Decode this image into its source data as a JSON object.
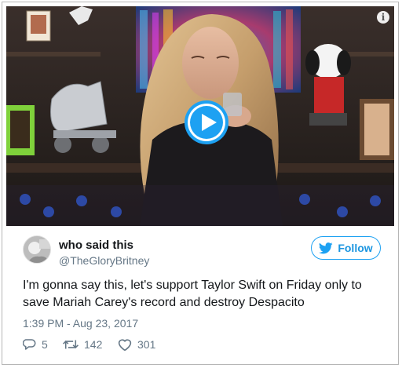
{
  "tweet": {
    "display_name": "who said this",
    "handle": "@TheGloryBritney",
    "follow_label": "Follow",
    "text": "I'm gonna say this, let's support Taylor Swift on Friday only to\nsave Mariah Carey's record and destroy Despacito",
    "timestamp": "1:39 PM - Aug 23, 2017",
    "replies": "5",
    "retweets": "142",
    "likes": "301"
  },
  "media": {
    "type": "video",
    "play_icon": "play-icon",
    "info_icon": "info-icon"
  },
  "colors": {
    "accent": "#1da1f2",
    "accent_text": "#1b95e0",
    "secondary_text": "#657786",
    "primary_text": "#14171a"
  }
}
